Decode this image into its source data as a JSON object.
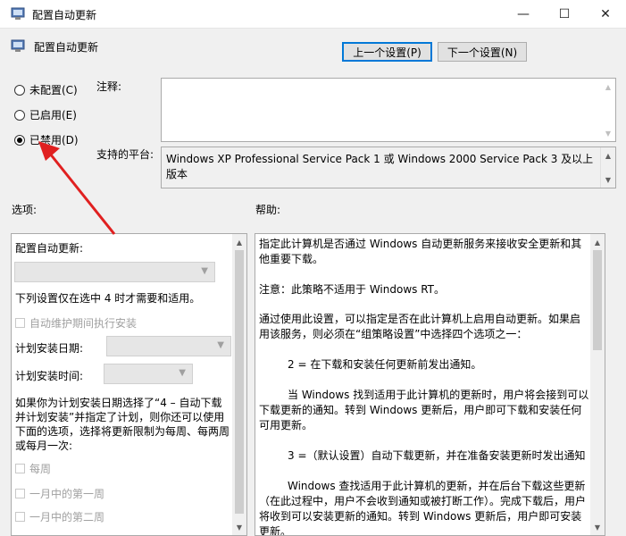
{
  "window": {
    "title": "配置自动更新",
    "controls": {
      "minimize": "—",
      "maximize": "☐",
      "close": "✕"
    }
  },
  "header": {
    "title": "配置自动更新",
    "prev_label": "上一个设置(P)",
    "next_label": "下一个设置(N)"
  },
  "state": {
    "options": [
      {
        "label": "未配置(C)",
        "checked": false
      },
      {
        "label": "已启用(E)",
        "checked": false
      },
      {
        "label": "已禁用(D)",
        "checked": true
      }
    ]
  },
  "comment": {
    "label": "注释:",
    "value": ""
  },
  "platform": {
    "label": "支持的平台:",
    "value": "Windows XP Professional Service Pack 1 或 Windows 2000 Service Pack 3 及以上版本"
  },
  "options_section": {
    "label": "选项:",
    "items": {
      "configure_label": "配置自动更新:",
      "note": "下列设置仅在选中 4 时才需要和适用。",
      "auto_maintenance": "自动维护期间执行安装",
      "schedule_day": "计划安装日期:",
      "schedule_time": "计划安装时间:",
      "desc": "如果你为计划安装日期选择了“4 – 自动下载并计划安装”并指定了计划，则你还可以使用下面的选项，选择将更新限制为每周、每两周或每月一次:",
      "weekly": "每周",
      "first_week": "一月中的第一周",
      "second_week": "一月中的第二周"
    }
  },
  "help_section": {
    "label": "帮助:",
    "paragraphs": [
      "指定此计算机是否通过 Windows 自动更新服务来接收安全更新和其他重要下载。",
      "注意：此策略不适用于 Windows RT。",
      "通过使用此设置，可以指定是否在此计算机上启用自动更新。如果启用该服务，则必须在“组策略设置”中选择四个选项之一：",
      "2 = 在下载和安装任何更新前发出通知。",
      "当 Windows 找到适用于此计算机的更新时，用户将会接到可以下载更新的通知。转到 Windows 更新后，用户即可下载和安装任何可用更新。",
      "3 =（默认设置）自动下载更新，并在准备安装更新时发出通知",
      "Windows 查找适用于此计算机的更新，并在后台下载这些更新（在此过程中，用户不会收到通知或被打断工作）。完成下载后，用户将收到可以安装更新的通知。转到 Windows 更新后，用户即可安装更新。"
    ]
  },
  "colors": {
    "accent": "#0078d7",
    "annotation_arrow": "#e02020"
  }
}
